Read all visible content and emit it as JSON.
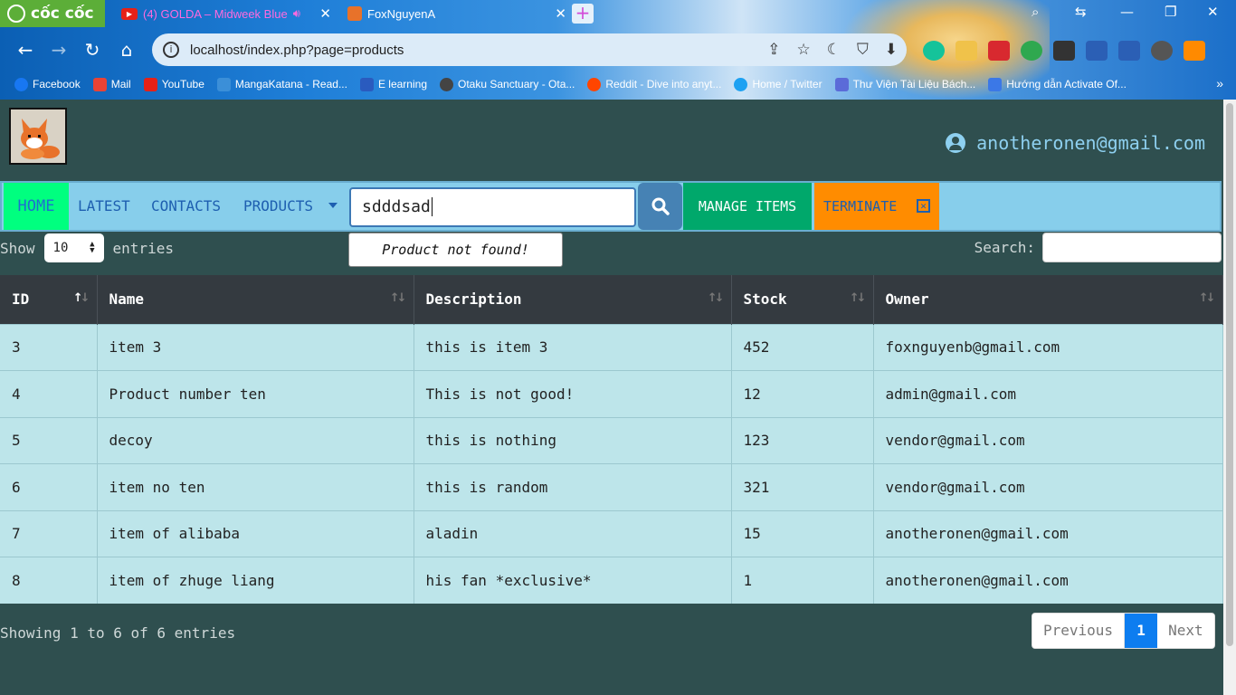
{
  "browser": {
    "brand": "cốc cốc",
    "tabs": [
      {
        "title": "(4) GOLDA – Midweek Blue"
      },
      {
        "title": "FoxNguyenA"
      }
    ],
    "url": "localhost/index.php?page=products",
    "bookmarks": [
      {
        "label": "Facebook",
        "color": "#1877f2"
      },
      {
        "label": "Mail",
        "color": "#ea4335"
      },
      {
        "label": "YouTube",
        "color": "#e62117"
      },
      {
        "label": "MangaKatana - Read...",
        "color": "#3b8fd8"
      },
      {
        "label": "E learning",
        "color": "#2a5bbf"
      },
      {
        "label": "Otaku Sanctuary - Ota...",
        "color": "#444444"
      },
      {
        "label": "Reddit - Dive into anyt...",
        "color": "#ff4500"
      },
      {
        "label": "Home / Twitter",
        "color": "#1da1f2"
      },
      {
        "label": "Thư Viện Tài Liệu Bách...",
        "color": "#5b6bd8"
      },
      {
        "label": "Hướng dẫn Activate Of...",
        "color": "#3b78e7"
      }
    ]
  },
  "header": {
    "user_email": "anotheronen@gmail.com"
  },
  "nav": {
    "home": "HOME",
    "latest": "LATEST",
    "contacts": "CONTACTS",
    "products": "PRODUCTS",
    "search_value": "sdddsad",
    "manage": "MANAGE ITEMS",
    "terminate": "TERMINATE",
    "tooltip": "Product not found!"
  },
  "datatable": {
    "show_label": "Show",
    "page_length": "10",
    "entries_label": "entries",
    "search_label": "Search:",
    "columns": [
      "ID",
      "Name",
      "Description",
      "Stock",
      "Owner"
    ],
    "rows": [
      [
        "3",
        "item 3",
        "this is item 3",
        "452",
        "foxnguyenb@gmail.com"
      ],
      [
        "4",
        "Product number ten",
        "This is not good!",
        "12",
        "admin@gmail.com"
      ],
      [
        "5",
        "decoy",
        "this is nothing",
        "123",
        "vendor@gmail.com"
      ],
      [
        "6",
        "item no ten",
        "this is random",
        "321",
        "vendor@gmail.com"
      ],
      [
        "7",
        "item of alibaba",
        "aladin",
        "15",
        "anotheronen@gmail.com"
      ],
      [
        "8",
        "item of zhuge liang",
        "his fan *exclusive*",
        "1",
        "anotheronen@gmail.com"
      ]
    ],
    "info": "Showing 1 to 6 of 6 entries",
    "pager": {
      "previous": "Previous",
      "current": "1",
      "next": "Next"
    }
  },
  "colors": {
    "page_bg": "#2f4f4f",
    "menubar": "#87ceeb",
    "home_active": "#00ff7f",
    "manage": "#00a86b",
    "terminate": "#ff8c00",
    "table_header": "#343a40",
    "table_row": "#bde5ea"
  }
}
